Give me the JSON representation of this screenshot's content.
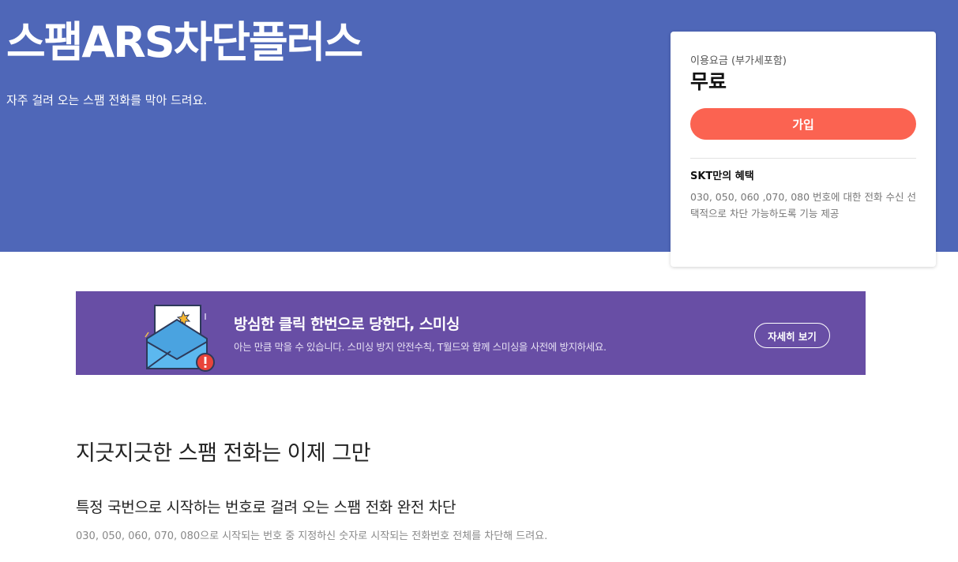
{
  "hero": {
    "title": "스팸ARS차단플러스",
    "description": "자주 걸려 오는 스팸 전화를 막아 드려요."
  },
  "price_card": {
    "label": "이용요금 (부가세포함)",
    "value": "무료",
    "join_label": "가입",
    "benefit_title": "SKT만의 혜택",
    "benefit_desc": "030, 050, 060 ,070, 080 번호에 대한 전화 수신 선택적으로 차단 가능하도록 기능 제공"
  },
  "banner": {
    "title": "방심한 클릭 한번으로 당한다, 스미싱",
    "description": "아는 만큼 막을 수 있습니다. 스미싱 방지 안전수칙, T월드와 함께 스미싱을 사전에 방지하세요.",
    "button_label": "자세히 보기"
  },
  "content": {
    "heading": "지긋지긋한 스팸 전화는 이제 그만",
    "feature_title": "특정 국번으로 시작하는 번호로 걸려 오는 스팸 전화 완전 차단",
    "feature_desc": "030, 050, 060, 070, 080으로 시작되는 번호 중 지정하신 숫자로 시작되는 전화번호 전체를 차단해 드려요."
  },
  "colors": {
    "hero_bg": "#4f67b8",
    "accent": "#fb6351",
    "banner_bg": "#684ea5"
  }
}
